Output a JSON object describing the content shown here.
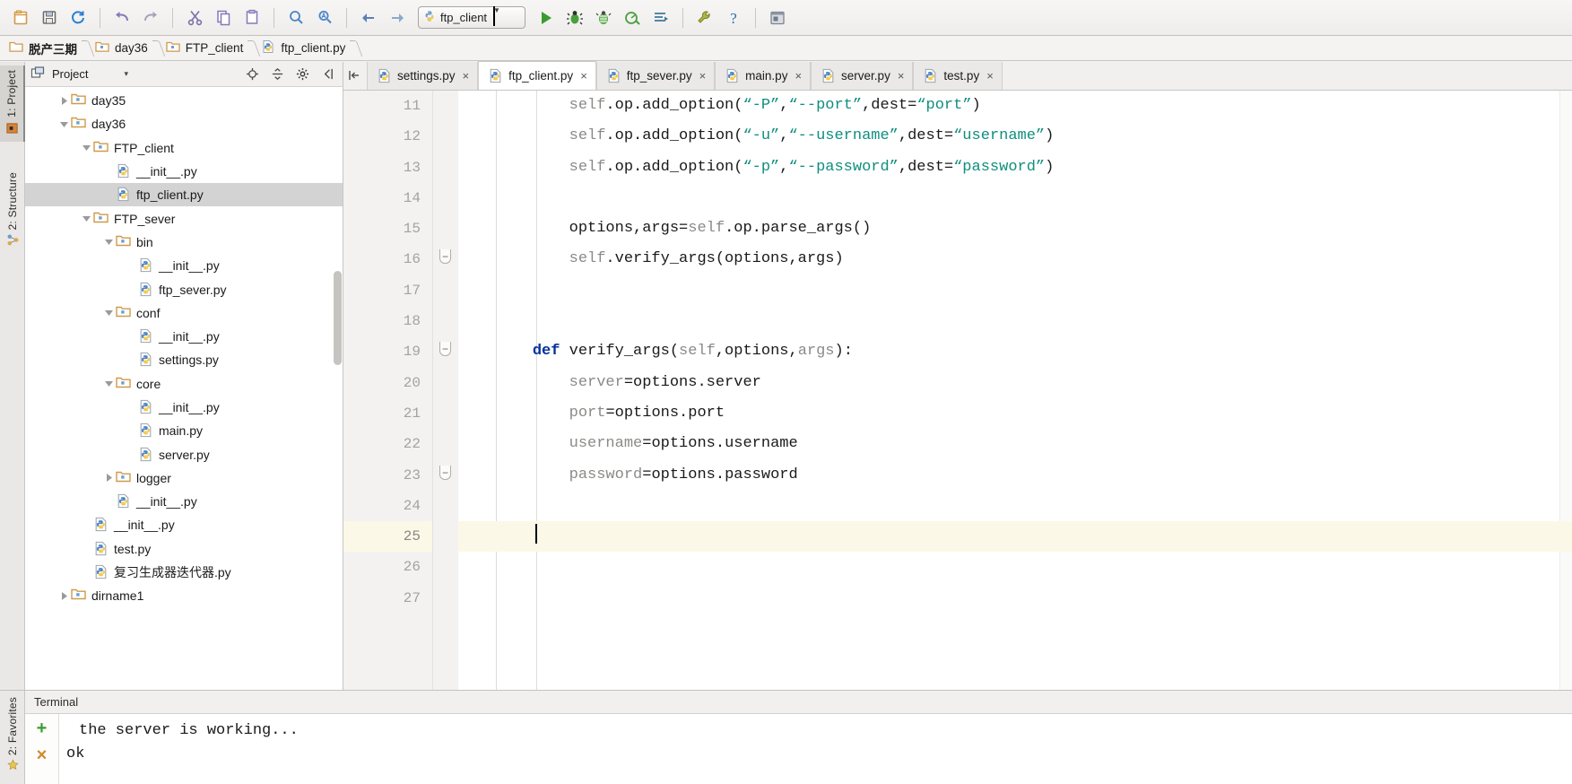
{
  "toolbar": {
    "buttons": [
      {
        "name": "new-file-icon",
        "tip": "New"
      },
      {
        "name": "save-all-icon",
        "tip": "Save All"
      },
      {
        "name": "sync-icon",
        "tip": "Synchronize"
      },
      {
        "name": "undo-icon",
        "tip": "Undo"
      },
      {
        "name": "redo-icon",
        "tip": "Redo"
      },
      {
        "name": "cut-icon",
        "tip": "Cut"
      },
      {
        "name": "copy-icon",
        "tip": "Copy"
      },
      {
        "name": "paste-icon",
        "tip": "Paste"
      },
      {
        "name": "find-icon",
        "tip": "Find"
      },
      {
        "name": "replace-icon",
        "tip": "Replace"
      },
      {
        "name": "back-icon",
        "tip": "Back"
      },
      {
        "name": "forward-icon",
        "tip": "Forward"
      }
    ],
    "run_config": {
      "label": "ftp_client",
      "icon": "python-config-icon"
    },
    "run_buttons": [
      {
        "name": "run-icon",
        "tip": "Run"
      },
      {
        "name": "debug-icon",
        "tip": "Debug"
      },
      {
        "name": "coverage-icon",
        "tip": "Run with Coverage"
      },
      {
        "name": "profile-icon",
        "tip": "Profile"
      },
      {
        "name": "attach-icon",
        "tip": "Attach"
      }
    ],
    "tail_buttons": [
      {
        "name": "settings-wrench-icon",
        "tip": "Settings"
      },
      {
        "name": "help-icon",
        "tip": "Help"
      }
    ],
    "far_right": {
      "name": "app-window-icon"
    }
  },
  "breadcrumb": {
    "items": [
      {
        "label": "脱产三期",
        "icon": "folder-icon",
        "bold": true
      },
      {
        "label": "day36",
        "icon": "folder-icon",
        "bold": false
      },
      {
        "label": "FTP_client",
        "icon": "folder-icon",
        "bold": false
      },
      {
        "label": "ftp_client.py",
        "icon": "python-file-icon",
        "bold": false
      }
    ]
  },
  "left_strip": {
    "tabs": [
      {
        "label": "1: Project",
        "icon": "project-icon",
        "selected": true
      },
      {
        "label": "2: Structure",
        "icon": "structure-icon",
        "selected": false
      }
    ]
  },
  "bottom_strip": {
    "tabs": [
      {
        "label": "2: Favorites",
        "icon": "favorites-icon"
      }
    ]
  },
  "project_panel": {
    "title": "Project",
    "dropdown_caret": "▾",
    "actions": [
      {
        "name": "locate-icon"
      },
      {
        "name": "collapse-all-icon"
      },
      {
        "name": "gear-icon"
      },
      {
        "name": "hide-icon"
      }
    ],
    "tree": [
      {
        "label": "day35",
        "indent": 1,
        "twist": "collapsed",
        "icon": "folder-icon",
        "selected": false
      },
      {
        "label": "day36",
        "indent": 1,
        "twist": "expanded",
        "icon": "folder-icon",
        "selected": false
      },
      {
        "label": "FTP_client",
        "indent": 2,
        "twist": "expanded",
        "icon": "folder-icon",
        "selected": false
      },
      {
        "label": "__init__.py",
        "indent": 3,
        "twist": "none",
        "icon": "python-file-icon",
        "selected": false
      },
      {
        "label": "ftp_client.py",
        "indent": 3,
        "twist": "none",
        "icon": "python-file-icon",
        "selected": true
      },
      {
        "label": "FTP_sever",
        "indent": 2,
        "twist": "expanded",
        "icon": "folder-icon",
        "selected": false
      },
      {
        "label": "bin",
        "indent": 3,
        "twist": "expanded",
        "icon": "folder-icon",
        "selected": false
      },
      {
        "label": "__init__.py",
        "indent": 4,
        "twist": "none",
        "icon": "python-file-icon",
        "selected": false
      },
      {
        "label": "ftp_sever.py",
        "indent": 4,
        "twist": "none",
        "icon": "python-file-icon",
        "selected": false
      },
      {
        "label": "conf",
        "indent": 3,
        "twist": "expanded",
        "icon": "folder-icon",
        "selected": false
      },
      {
        "label": "__init__.py",
        "indent": 4,
        "twist": "none",
        "icon": "python-file-icon",
        "selected": false
      },
      {
        "label": "settings.py",
        "indent": 4,
        "twist": "none",
        "icon": "python-file-icon",
        "selected": false
      },
      {
        "label": "core",
        "indent": 3,
        "twist": "expanded",
        "icon": "folder-icon",
        "selected": false
      },
      {
        "label": "__init__.py",
        "indent": 4,
        "twist": "none",
        "icon": "python-file-icon",
        "selected": false
      },
      {
        "label": "main.py",
        "indent": 4,
        "twist": "none",
        "icon": "python-file-icon",
        "selected": false
      },
      {
        "label": "server.py",
        "indent": 4,
        "twist": "none",
        "icon": "python-file-icon",
        "selected": false
      },
      {
        "label": "logger",
        "indent": 3,
        "twist": "collapsed",
        "icon": "folder-icon",
        "selected": false
      },
      {
        "label": "__init__.py",
        "indent": 3,
        "twist": "none",
        "icon": "python-file-icon",
        "selected": false
      },
      {
        "label": "__init__.py",
        "indent": 2,
        "twist": "none",
        "icon": "python-file-icon",
        "selected": false
      },
      {
        "label": "test.py",
        "indent": 2,
        "twist": "none",
        "icon": "python-file-icon",
        "selected": false
      },
      {
        "label": "复习生成器迭代器.py",
        "indent": 2,
        "twist": "none",
        "icon": "python-file-icon",
        "selected": false
      },
      {
        "label": "dirname1",
        "indent": 1,
        "twist": "collapsed",
        "icon": "folder-icon",
        "selected": false
      }
    ]
  },
  "editor": {
    "tabs": [
      {
        "label": "settings.py",
        "active": false,
        "icon": "python-file-icon",
        "close": "×"
      },
      {
        "label": "ftp_client.py",
        "active": true,
        "icon": "python-file-icon",
        "close": "×"
      },
      {
        "label": "ftp_sever.py",
        "active": false,
        "icon": "python-file-icon",
        "close": "×"
      },
      {
        "label": "main.py",
        "active": false,
        "icon": "python-file-icon",
        "close": "×"
      },
      {
        "label": "server.py",
        "active": false,
        "icon": "python-file-icon",
        "close": "×"
      },
      {
        "label": "test.py",
        "active": false,
        "icon": "python-file-icon",
        "close": "×"
      }
    ],
    "line_numbers": [
      "11",
      "12",
      "13",
      "14",
      "15",
      "16",
      "17",
      "18",
      "19",
      "20",
      "21",
      "22",
      "23",
      "24",
      "25",
      "26",
      "27"
    ],
    "current_line": "25",
    "lines": [
      {
        "n": "11",
        "tokens": [
          {
            "t": "        self",
            "c": "gray"
          },
          {
            "t": ".op.add_option(",
            "c": "plain"
          },
          {
            "t": "“-P”",
            "c": "str"
          },
          {
            "t": ",",
            "c": "plain"
          },
          {
            "t": "“--port”",
            "c": "str"
          },
          {
            "t": ",dest=",
            "c": "plain"
          },
          {
            "t": "“port”",
            "c": "str"
          },
          {
            "t": ")",
            "c": "plain"
          }
        ]
      },
      {
        "n": "12",
        "tokens": [
          {
            "t": "        self",
            "c": "gray"
          },
          {
            "t": ".op.add_option(",
            "c": "plain"
          },
          {
            "t": "“-u”",
            "c": "str"
          },
          {
            "t": ",",
            "c": "plain"
          },
          {
            "t": "“--username”",
            "c": "str"
          },
          {
            "t": ",dest=",
            "c": "plain"
          },
          {
            "t": "“username”",
            "c": "str"
          },
          {
            "t": ")",
            "c": "plain"
          }
        ]
      },
      {
        "n": "13",
        "tokens": [
          {
            "t": "        self",
            "c": "gray"
          },
          {
            "t": ".op.add_option(",
            "c": "plain"
          },
          {
            "t": "“-p”",
            "c": "str"
          },
          {
            "t": ",",
            "c": "plain"
          },
          {
            "t": "“--password”",
            "c": "str"
          },
          {
            "t": ",dest=",
            "c": "plain"
          },
          {
            "t": "“password”",
            "c": "str"
          },
          {
            "t": ")",
            "c": "plain"
          }
        ]
      },
      {
        "n": "14",
        "tokens": []
      },
      {
        "n": "15",
        "tokens": [
          {
            "t": "        options,args=",
            "c": "plain"
          },
          {
            "t": "self",
            "c": "gray"
          },
          {
            "t": ".op.parse_args()",
            "c": "plain"
          }
        ]
      },
      {
        "n": "16",
        "tokens": [
          {
            "t": "        self",
            "c": "gray"
          },
          {
            "t": ".verify_args(options,args)",
            "c": "plain"
          }
        ]
      },
      {
        "n": "17",
        "tokens": []
      },
      {
        "n": "18",
        "tokens": []
      },
      {
        "n": "19",
        "tokens": [
          {
            "t": "    ",
            "c": "plain"
          },
          {
            "t": "def",
            "c": "kw"
          },
          {
            "t": " verify_args(",
            "c": "plain"
          },
          {
            "t": "self",
            "c": "gray"
          },
          {
            "t": ",options,",
            "c": "plain"
          },
          {
            "t": "args",
            "c": "gray"
          },
          {
            "t": "):",
            "c": "plain"
          }
        ]
      },
      {
        "n": "20",
        "tokens": [
          {
            "t": "        ",
            "c": "plain"
          },
          {
            "t": "server",
            "c": "gray"
          },
          {
            "t": "=options.server",
            "c": "plain"
          }
        ]
      },
      {
        "n": "21",
        "tokens": [
          {
            "t": "        ",
            "c": "plain"
          },
          {
            "t": "port",
            "c": "gray"
          },
          {
            "t": "=options.port",
            "c": "plain"
          }
        ]
      },
      {
        "n": "22",
        "tokens": [
          {
            "t": "        ",
            "c": "plain"
          },
          {
            "t": "username",
            "c": "gray"
          },
          {
            "t": "=options.username",
            "c": "plain"
          }
        ]
      },
      {
        "n": "23",
        "tokens": [
          {
            "t": "        ",
            "c": "plain"
          },
          {
            "t": "password",
            "c": "gray"
          },
          {
            "t": "=options.password",
            "c": "plain"
          }
        ]
      },
      {
        "n": "24",
        "tokens": []
      },
      {
        "n": "25",
        "tokens": [],
        "caret": true
      },
      {
        "n": "26",
        "tokens": []
      },
      {
        "n": "27",
        "tokens": []
      }
    ]
  },
  "terminal": {
    "title": "Terminal",
    "new_session_label": "+",
    "close_session_label": "×",
    "output": [
      "the server is working...",
      "ok"
    ]
  },
  "colors": {
    "keyword": "#00339a",
    "string": "#0e8f7e",
    "grayed_identifier": "#8c8a87",
    "current_line_bg": "#fcf8e8",
    "tree_selection_bg": "#d3d3d3",
    "run_green": "#3a9c2f"
  }
}
